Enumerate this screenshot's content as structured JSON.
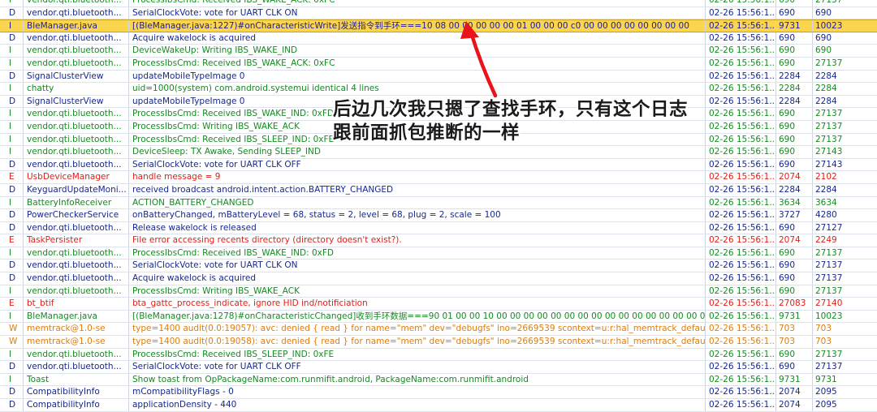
{
  "log_rows": [
    {
      "level": "I",
      "tag": "vendor.qti.bluetooth...",
      "message": "ProcessIbsCmd: Received IBS_WAKE_ACK: 0xFC",
      "time": "02-26 15:56:1...",
      "pid": "690",
      "tid": "27137"
    },
    {
      "level": "D",
      "tag": "vendor.qti.bluetooth...",
      "message": "SerialClockVote: vote for UART CLK ON",
      "time": "02-26 15:56:1...",
      "pid": "690",
      "tid": "690"
    },
    {
      "level": "I",
      "tag": "BleManager.java",
      "message": "[(BleManager.java:1227)#onCharacteristicWrite]发送指令到手环===10 08 00 00 00 00 00 01 00 00 00 c0 00 00 00 00 00 00 00 00",
      "time": "02-26 15:56:1...",
      "pid": "9731",
      "tid": "10023",
      "selected": true
    },
    {
      "level": "D",
      "tag": "vendor.qti.bluetooth...",
      "message": "Acquire wakelock is acquired",
      "time": "02-26 15:56:1...",
      "pid": "690",
      "tid": "690"
    },
    {
      "level": "I",
      "tag": "vendor.qti.bluetooth...",
      "message": "DeviceWakeUp: Writing IBS_WAKE_IND",
      "time": "02-26 15:56:1...",
      "pid": "690",
      "tid": "690"
    },
    {
      "level": "I",
      "tag": "vendor.qti.bluetooth...",
      "message": "ProcessIbsCmd: Received IBS_WAKE_ACK: 0xFC",
      "time": "02-26 15:56:1...",
      "pid": "690",
      "tid": "27137"
    },
    {
      "level": "D",
      "tag": "SignalClusterView",
      "message": "updateMobileTypeImage 0",
      "time": "02-26 15:56:1...",
      "pid": "2284",
      "tid": "2284"
    },
    {
      "level": "I",
      "tag": "chatty",
      "message": "uid=1000(system) com.android.systemui identical 4 lines",
      "time": "02-26 15:56:1...",
      "pid": "2284",
      "tid": "2284"
    },
    {
      "level": "D",
      "tag": "SignalClusterView",
      "message": "updateMobileTypeImage 0",
      "time": "02-26 15:56:1...",
      "pid": "2284",
      "tid": "2284"
    },
    {
      "level": "I",
      "tag": "vendor.qti.bluetooth...",
      "message": "ProcessIbsCmd: Received IBS_WAKE_IND: 0xFD",
      "time": "02-26 15:56:1...",
      "pid": "690",
      "tid": "27137"
    },
    {
      "level": "I",
      "tag": "vendor.qti.bluetooth...",
      "message": "ProcessIbsCmd: Writing IBS_WAKE_ACK",
      "time": "02-26 15:56:1...",
      "pid": "690",
      "tid": "27137"
    },
    {
      "level": "I",
      "tag": "vendor.qti.bluetooth...",
      "message": "ProcessIbsCmd: Received IBS_SLEEP_IND: 0xFE",
      "time": "02-26 15:56:1...",
      "pid": "690",
      "tid": "27137"
    },
    {
      "level": "I",
      "tag": "vendor.qti.bluetooth...",
      "message": "DeviceSleep: TX Awake, Sending SLEEP_IND",
      "time": "02-26 15:56:1...",
      "pid": "690",
      "tid": "27143"
    },
    {
      "level": "D",
      "tag": "vendor.qti.bluetooth...",
      "message": "SerialClockVote: vote for UART CLK OFF",
      "time": "02-26 15:56:1...",
      "pid": "690",
      "tid": "27143"
    },
    {
      "level": "E",
      "tag": "UsbDeviceManager",
      "message": "handle message = 9",
      "time": "02-26 15:56:1...",
      "pid": "2074",
      "tid": "2102"
    },
    {
      "level": "D",
      "tag": "KeyguardUpdateMoni...",
      "message": "received broadcast android.intent.action.BATTERY_CHANGED",
      "time": "02-26 15:56:1...",
      "pid": "2284",
      "tid": "2284"
    },
    {
      "level": "I",
      "tag": "BatteryInfoReceiver",
      "message": "ACTION_BATTERY_CHANGED",
      "time": "02-26 15:56:1...",
      "pid": "3634",
      "tid": "3634"
    },
    {
      "level": "D",
      "tag": "PowerCheckerService",
      "message": "onBatteryChanged, mBatteryLevel = 68, status = 2, level = 68, plug = 2, scale = 100",
      "time": "02-26 15:56:1...",
      "pid": "3727",
      "tid": "4280"
    },
    {
      "level": "D",
      "tag": "vendor.qti.bluetooth...",
      "message": "Release wakelock is released",
      "time": "02-26 15:56:1...",
      "pid": "690",
      "tid": "27127"
    },
    {
      "level": "E",
      "tag": "TaskPersister",
      "message": "File error accessing recents directory (directory doesn't exist?).",
      "time": "02-26 15:56:1...",
      "pid": "2074",
      "tid": "2249"
    },
    {
      "level": "I",
      "tag": "vendor.qti.bluetooth...",
      "message": "ProcessIbsCmd: Received IBS_WAKE_IND: 0xFD",
      "time": "02-26 15:56:1...",
      "pid": "690",
      "tid": "27137"
    },
    {
      "level": "D",
      "tag": "vendor.qti.bluetooth...",
      "message": "SerialClockVote: vote for UART CLK ON",
      "time": "02-26 15:56:1...",
      "pid": "690",
      "tid": "27137"
    },
    {
      "level": "D",
      "tag": "vendor.qti.bluetooth...",
      "message": "Acquire wakelock is acquired",
      "time": "02-26 15:56:1...",
      "pid": "690",
      "tid": "27137"
    },
    {
      "level": "I",
      "tag": "vendor.qti.bluetooth...",
      "message": "ProcessIbsCmd: Writing IBS_WAKE_ACK",
      "time": "02-26 15:56:1...",
      "pid": "690",
      "tid": "27137"
    },
    {
      "level": "E",
      "tag": "bt_btif",
      "message": "bta_gattc_process_indicate, ignore HID ind/notificiation",
      "time": "02-26 15:56:1...",
      "pid": "27083",
      "tid": "27140"
    },
    {
      "level": "I",
      "tag": "BleManager.java",
      "message": "[(BleManager.java:1278)#onCharacteristicChanged]收到手环数据===90 01 00 00 10 00 00 00 00 00 00 00 00 00 00 00 00 00 00 00 00 00",
      "time": "02-26 15:56:1...",
      "pid": "9731",
      "tid": "10023"
    },
    {
      "level": "W",
      "tag": "memtrack@1.0-se",
      "message": "type=1400 audit(0.0:19057): avc: denied { read } for name=\"mem\" dev=\"debugfs\" ino=2669539 scontext=u:r:hal_memtrack_default:s0 tcon...",
      "time": "02-26 15:56:1...",
      "pid": "703",
      "tid": "703"
    },
    {
      "level": "W",
      "tag": "memtrack@1.0-se",
      "message": "type=1400 audit(0.0:19058): avc: denied { read } for name=\"mem\" dev=\"debugfs\" ino=2669539 scontext=u:r:hal_memtrack_default:s0 tcon...",
      "time": "02-26 15:56:1...",
      "pid": "703",
      "tid": "703"
    },
    {
      "level": "I",
      "tag": "vendor.qti.bluetooth...",
      "message": "ProcessIbsCmd: Received IBS_SLEEP_IND: 0xFE",
      "time": "02-26 15:56:1...",
      "pid": "690",
      "tid": "27137"
    },
    {
      "level": "D",
      "tag": "vendor.qti.bluetooth...",
      "message": "SerialClockVote: vote for UART CLK OFF",
      "time": "02-26 15:56:1...",
      "pid": "690",
      "tid": "27137"
    },
    {
      "level": "I",
      "tag": "Toast",
      "message": "Show toast from OpPackageName:com.runmifit.android, PackageName:com.runmifit.android",
      "time": "02-26 15:56:1...",
      "pid": "9731",
      "tid": "9731"
    },
    {
      "level": "D",
      "tag": "CompatibilityInfo",
      "message": "mCompatibilityFlags - 0",
      "time": "02-26 15:56:1...",
      "pid": "2074",
      "tid": "2095"
    },
    {
      "level": "D",
      "tag": "CompatibilityInfo",
      "message": "applicationDensity - 440",
      "time": "02-26 15:56:1...",
      "pid": "2074",
      "tid": "2095"
    }
  ],
  "annotation": {
    "line1": "后边几次我只摁了查找手环，只有这个日志",
    "line2": "跟前面抓包推断的一样",
    "color": "#1a1a1a",
    "arrow_color": "#e8141a"
  },
  "colors": {
    "I": "#168a24",
    "D": "#16288f",
    "E": "#e0201a",
    "W": "#e07d10",
    "selected_bg": "#fbd54d"
  }
}
